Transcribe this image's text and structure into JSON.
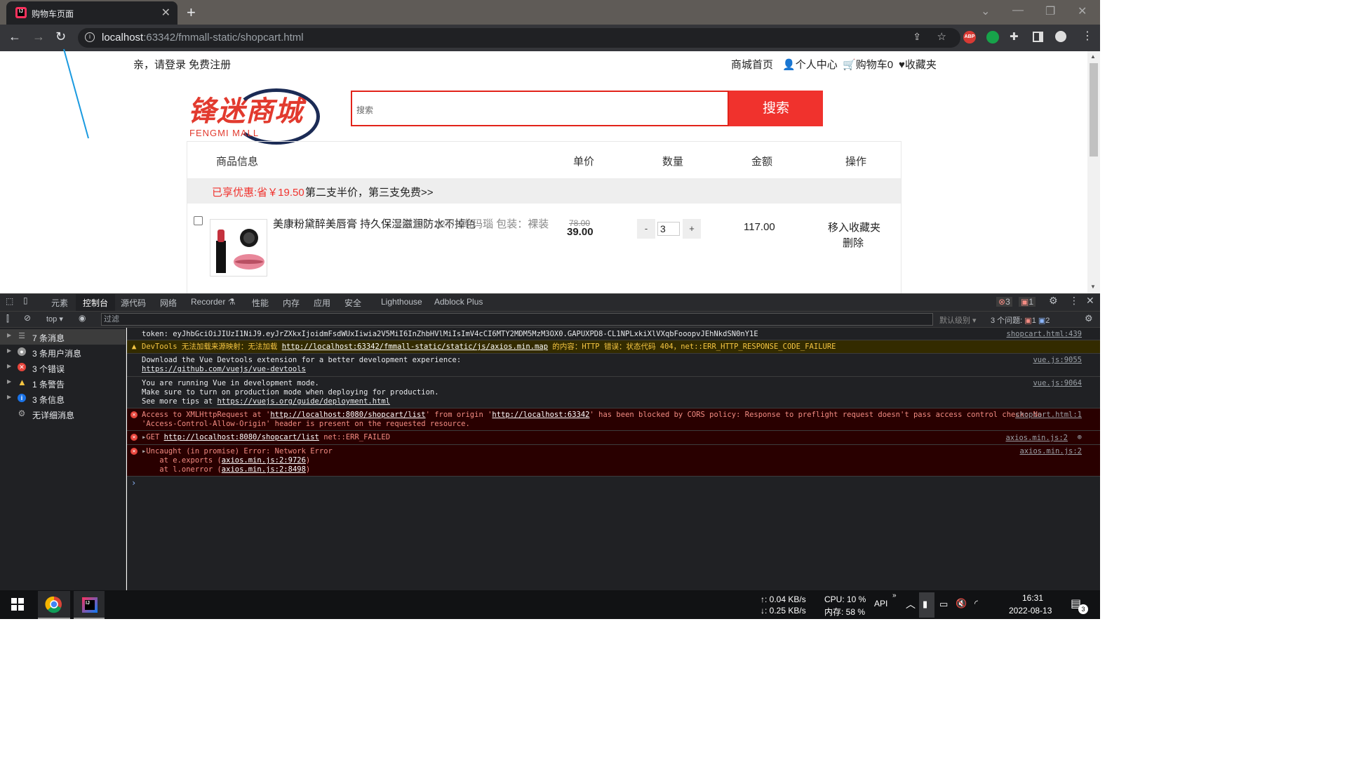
{
  "browser": {
    "tab_title": "购物车页面",
    "url_host": "localhost",
    "url_rest": ":63342/fmmall-static/shopcart.html"
  },
  "page": {
    "login_text": "亲，请登录 免费注册",
    "nav": [
      "商城首页",
      "个人中心",
      "购物车0",
      "收藏夹"
    ],
    "logo_cn": "锋迷商城",
    "logo_en": "FENGMI MALL",
    "search_placeholder": "搜索",
    "search_button": "搜索",
    "table_headers": [
      "商品信息",
      "单价",
      "数量",
      "金额",
      "操作"
    ],
    "promo_discount": "已享优惠:省￥19.50",
    "promo_text": "第二支半价，第三支免费>>",
    "product": {
      "name": "美康粉黛醉美唇膏 持久保湿滋润防水不掉色",
      "spec": "颜色：12#川南玛瑙 包装：裸装",
      "old_price": "78.00",
      "price": "39.00",
      "minus": "-",
      "qty": "3",
      "plus": "+",
      "amount": "117.00",
      "action_fav": "移入收藏夹",
      "action_del": "删除"
    }
  },
  "devtools": {
    "tabs": [
      "元素",
      "控制台",
      "源代码",
      "网络",
      "Recorder",
      "性能",
      "内存",
      "应用",
      "安全",
      "Lighthouse",
      "Adblock Plus"
    ],
    "error_count": "3",
    "issue_count": "1",
    "context": "top",
    "filter_placeholder": "过滤",
    "level": "默认级别",
    "issues_label": "3 个问题:",
    "issues_err": "1",
    "issues_info": "2",
    "sidebar": [
      {
        "label": "7 条消息",
        "icon": "list-icon"
      },
      {
        "label": "3 条用户消息",
        "icon": "user-icon"
      },
      {
        "label": "3 个错误",
        "icon": "error-icon"
      },
      {
        "label": "1 条警告",
        "icon": "warning-icon"
      },
      {
        "label": "3 条信息",
        "icon": "info-icon"
      },
      {
        "label": "无详细消息",
        "icon": "gear-icon"
      }
    ],
    "messages": {
      "m1": "token: eyJhbGciOiJIUzI1NiJ9.eyJrZXkxIjoidmFsdWUxIiwia2V5MiI6InZhbHVlMiIsImV4cCI6MTY2MDM5MzM3OX0.GAPUXPD8-CL1NPLxkiXlVXqbFooopvJEhNkdSN0nY1E",
      "m1_src": "shopcart.html:439",
      "m2_pre": "DevTools 无法加载来源映射：无法加载 ",
      "m2_link": "http://localhost:63342/fmmall-static/static/js/axios.min.map",
      "m2_post": " 的内容：HTTP 错误：状态代码 404，net::ERR_HTTP_RESPONSE_CODE_FAILURE",
      "m3_l1": "Download the Vue Devtools extension for a better development experience:",
      "m3_l2": "https://github.com/vuejs/vue-devtools",
      "m3_src": "vue.js:9055",
      "m4_l1": "You are running Vue in development mode.",
      "m4_l2": "Make sure to turn on production mode when deploying for production.",
      "m4_l3a": "See more tips at ",
      "m4_l3b": "https://vuejs.org/guide/deployment.html",
      "m4_src": "vue.js:9064",
      "m5_a": "Access to XMLHttpRequest at '",
      "m5_b": "http://localhost:8080/shopcart/list",
      "m5_c": "' from origin '",
      "m5_d": "http://localhost:63342",
      "m5_e": "' has been blocked by CORS policy: Response to preflight request doesn't pass access control check: No",
      "m5_l2": "'Access-Control-Allow-Origin' header is present on the requested resource.",
      "m5_src": "shopcart.html:1",
      "m6_a": "GET ",
      "m6_b": "http://localhost:8080/shopcart/list",
      "m6_c": " net::ERR_FAILED",
      "m6_src": "axios.min.js:2",
      "m7_l1": "Uncaught (in promise) Error: Network Error",
      "m7_l2a": "    at e.exports (",
      "m7_l2b": "axios.min.js:2:9726",
      "m7_l3a": "    at l.onerror (",
      "m7_l3b": "axios.min.js:2:8498",
      "m7_src": "axios.min.js:2"
    }
  },
  "taskbar": {
    "net_up": "↑: 0.04 KB/s",
    "net_down": "↓: 0.25 KB/s",
    "cpu": "CPU: 10 %",
    "mem": "内存: 58 %",
    "api": "API",
    "time": "16:31",
    "date": "2022-08-13",
    "notif": "3"
  }
}
